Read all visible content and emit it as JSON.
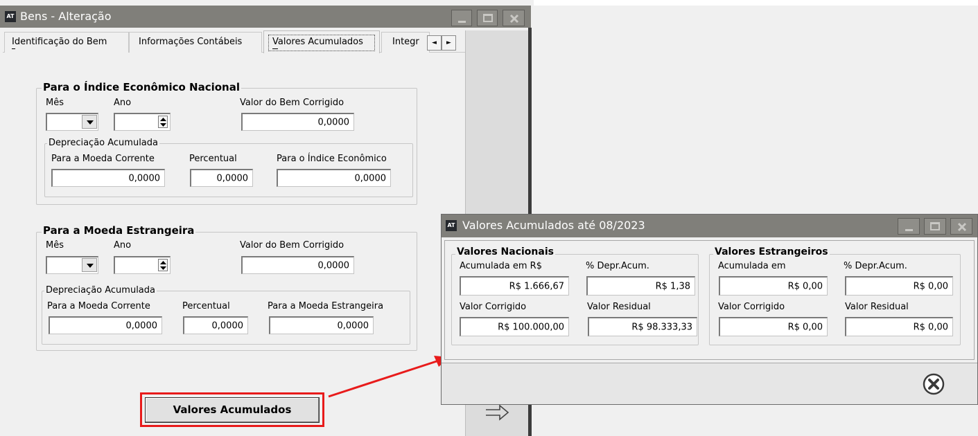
{
  "main_window": {
    "icon_text": "AT",
    "title": "Bens - Alteração",
    "tabs": [
      {
        "label": "Identificação do Bem"
      },
      {
        "label": "Informações Contábeis"
      },
      {
        "label": "Valores Acumulados"
      },
      {
        "label": "Integr"
      }
    ],
    "tab_scroll_left": "◄",
    "tab_scroll_right": "►",
    "group_national": {
      "legend": "Para o Índice Econômico Nacional",
      "month_label": "Mês",
      "year_label": "Ano",
      "corrected_value_label": "Valor do Bem Corrigido",
      "corrected_value": "0,0000",
      "depreciation": {
        "legend": "Depreciação Acumulada",
        "current_currency_label": "Para a Moeda Corrente",
        "current_currency_value": "0,0000",
        "percent_label": "Percentual",
        "percent_value": "0,0000",
        "index_label": "Para o Índice Econômico",
        "index_value": "0,0000"
      }
    },
    "group_foreign": {
      "legend": "Para a Moeda Estrangeira",
      "month_label": "Mês",
      "year_label": "Ano",
      "corrected_value_label": "Valor do Bem Corrigido",
      "corrected_value": "0,0000",
      "depreciation": {
        "legend": "Depreciação Acumulada",
        "current_currency_label": "Para a Moeda Corrente",
        "current_currency_value": "0,0000",
        "percent_label": "Percentual",
        "percent_value": "0,0000",
        "foreign_label": "Para a Moeda Estrangeira",
        "foreign_value": "0,0000"
      }
    },
    "accumulated_button_label": "Valores Acumulados"
  },
  "dialog": {
    "icon_text": "AT",
    "title": "Valores Acumulados até 08/2023",
    "national": {
      "legend": "Valores Nacionais",
      "accumulated_label": "Acumulada em R$",
      "accumulated_value": "R$ 1.666,67",
      "depr_label": "% Depr.Acum.",
      "depr_value": "R$ 1,38",
      "corrected_label": "Valor Corrigido",
      "corrected_value": "R$ 100.000,00",
      "residual_label": "Valor Residual",
      "residual_value": "R$ 98.333,33"
    },
    "foreign": {
      "legend": "Valores Estrangeiros",
      "accumulated_label": "Acumulada em",
      "accumulated_value": "R$ 0,00",
      "depr_label": "% Depr.Acum.",
      "depr_value": "R$ 0,00",
      "corrected_label": "Valor Corrigido",
      "corrected_value": "R$ 0,00",
      "residual_label": "Valor Residual",
      "residual_value": "R$ 0,00"
    }
  },
  "colors": {
    "titlebar": "#807f7a",
    "window_bg": "#f0f0f0",
    "side_panel": "#dcdcdc",
    "annotation": "#e81b1b"
  },
  "icons": [
    "app-icon",
    "minimize-icon",
    "maximize-icon",
    "close-icon",
    "combo-arrow-icon",
    "spin-icon",
    "close-circle-icon",
    "right-arrow-icon"
  ]
}
